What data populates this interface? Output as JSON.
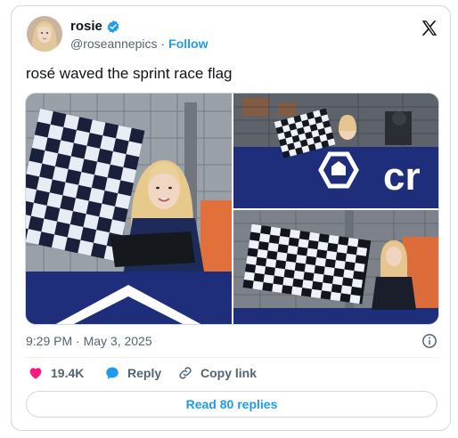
{
  "author": {
    "display_name": "rosie",
    "handle": "@roseannepics",
    "follow_label": "Follow",
    "separator": "·"
  },
  "tweet": {
    "text": "rosé waved the sprint race flag",
    "timestamp": "9:29 PM · May 3, 2025"
  },
  "actions": {
    "like_count": "19.4K",
    "reply_label": "Reply",
    "copy_label": "Copy link"
  },
  "read_replies_label": "Read 80 replies",
  "media": {
    "banner_text": "cr"
  },
  "colors": {
    "accent": "#1d9bf0",
    "like": "#f91880",
    "muted": "#536471",
    "navy": "#1b2a6b"
  },
  "icons": [
    "verified-badge-icon",
    "x-logo-icon",
    "info-icon",
    "heart-icon",
    "reply-bubble-icon",
    "link-icon"
  ]
}
